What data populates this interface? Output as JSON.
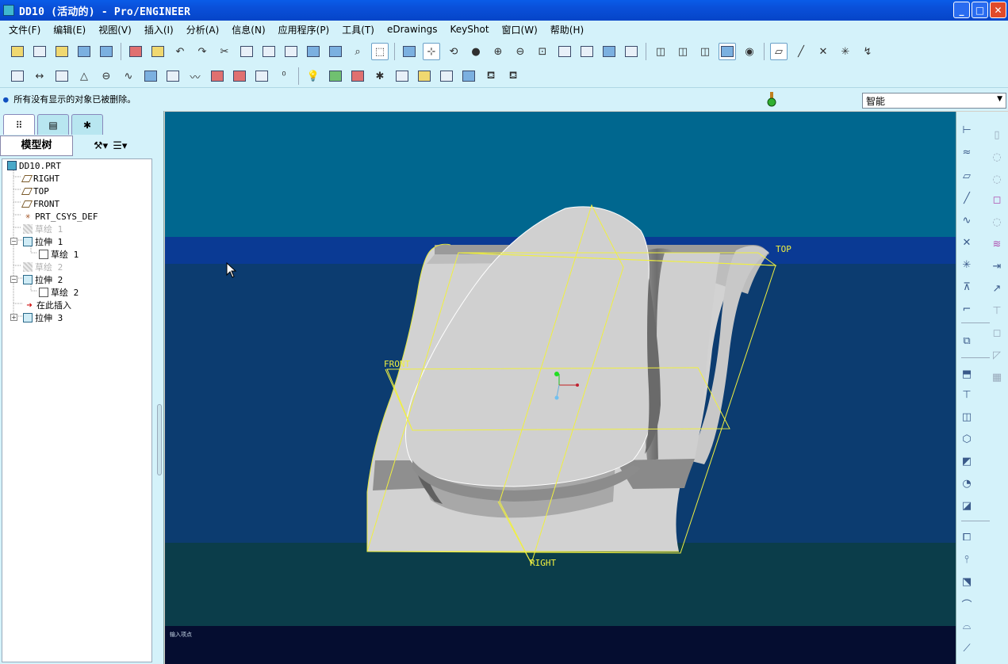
{
  "window": {
    "title": "DD10 (活动的) - Pro/ENGINEER"
  },
  "menu": [
    {
      "label": "文件(F)"
    },
    {
      "label": "编辑(E)"
    },
    {
      "label": "视图(V)"
    },
    {
      "label": "插入(I)"
    },
    {
      "label": "分析(A)"
    },
    {
      "label": "信息(N)"
    },
    {
      "label": "应用程序(P)"
    },
    {
      "label": "工具(T)"
    },
    {
      "label": "eDrawings"
    },
    {
      "label": "KeyShot"
    },
    {
      "label": "窗口(W)"
    },
    {
      "label": "帮助(H)"
    }
  ],
  "message": "所有没有显示的对象已被删除。",
  "filter": {
    "value": "智能"
  },
  "model_tree": {
    "tab_label": "模型树",
    "nodes": [
      {
        "label": "DD10.PRT"
      },
      {
        "label": "RIGHT"
      },
      {
        "label": "TOP"
      },
      {
        "label": "FRONT"
      },
      {
        "label": "PRT_CSYS_DEF"
      },
      {
        "label": "草绘 1"
      },
      {
        "label": "拉伸 1"
      },
      {
        "label": "草绘 1"
      },
      {
        "label": "草绘 2"
      },
      {
        "label": "拉伸 2"
      },
      {
        "label": "草绘 2"
      },
      {
        "label": "在此插入"
      },
      {
        "label": "拉伸 3"
      }
    ]
  },
  "viewport": {
    "labels": {
      "top": "TOP",
      "front": "FRONT",
      "right": "RIGHT"
    },
    "status": "输入项点"
  },
  "colors": {
    "bg_top": "#00678f",
    "bg_band": "#0a3a94",
    "bg_mid": "#0c3c70",
    "bg_low": "#0b3d4a",
    "bg_bottom": "#050d30",
    "plane": "#f0f040",
    "part": "#d2d2d2"
  }
}
